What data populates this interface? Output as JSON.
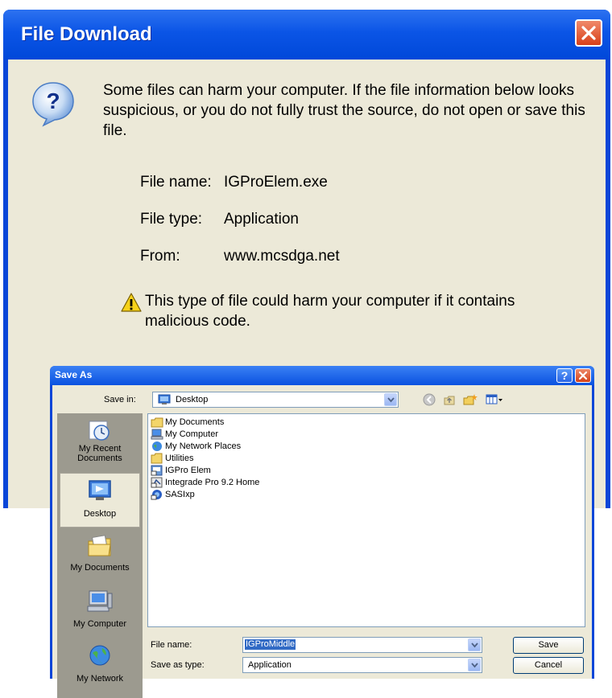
{
  "file_download": {
    "title": "File Download",
    "message": "Some files can harm your computer. If the file information below looks suspicious, or you do not fully trust the source, do not open or save this file.",
    "fields": [
      {
        "label": "File name:",
        "value": "IGProElem.exe"
      },
      {
        "label": "File type:",
        "value": "Application"
      },
      {
        "label": "From:",
        "value": "www.mcsdga.net"
      }
    ],
    "warning": "This type of file could harm your computer if it contains malicious code."
  },
  "save_as": {
    "title": "Save As",
    "save_in_label": "Save in:",
    "save_in_value": "Desktop",
    "places": [
      {
        "label": "My Recent Documents"
      },
      {
        "label": "Desktop"
      },
      {
        "label": "My Documents"
      },
      {
        "label": "My Computer"
      },
      {
        "label": "My Network"
      }
    ],
    "files": [
      {
        "name": "My Documents"
      },
      {
        "name": "My Computer"
      },
      {
        "name": "My Network Places"
      },
      {
        "name": "Utilities"
      },
      {
        "name": "IGPro Elem"
      },
      {
        "name": "Integrade Pro 9.2 Home"
      },
      {
        "name": "SASIxp"
      }
    ],
    "file_name_label": "File name:",
    "file_name_value": "IGProMiddle",
    "save_type_label": "Save as type:",
    "save_type_value": "Application",
    "save_button": "Save",
    "cancel_button": "Cancel"
  },
  "colors": {
    "titlebar": "#0b55e6",
    "dialog_bg": "#ece9d8",
    "selection": "#316ac5"
  }
}
